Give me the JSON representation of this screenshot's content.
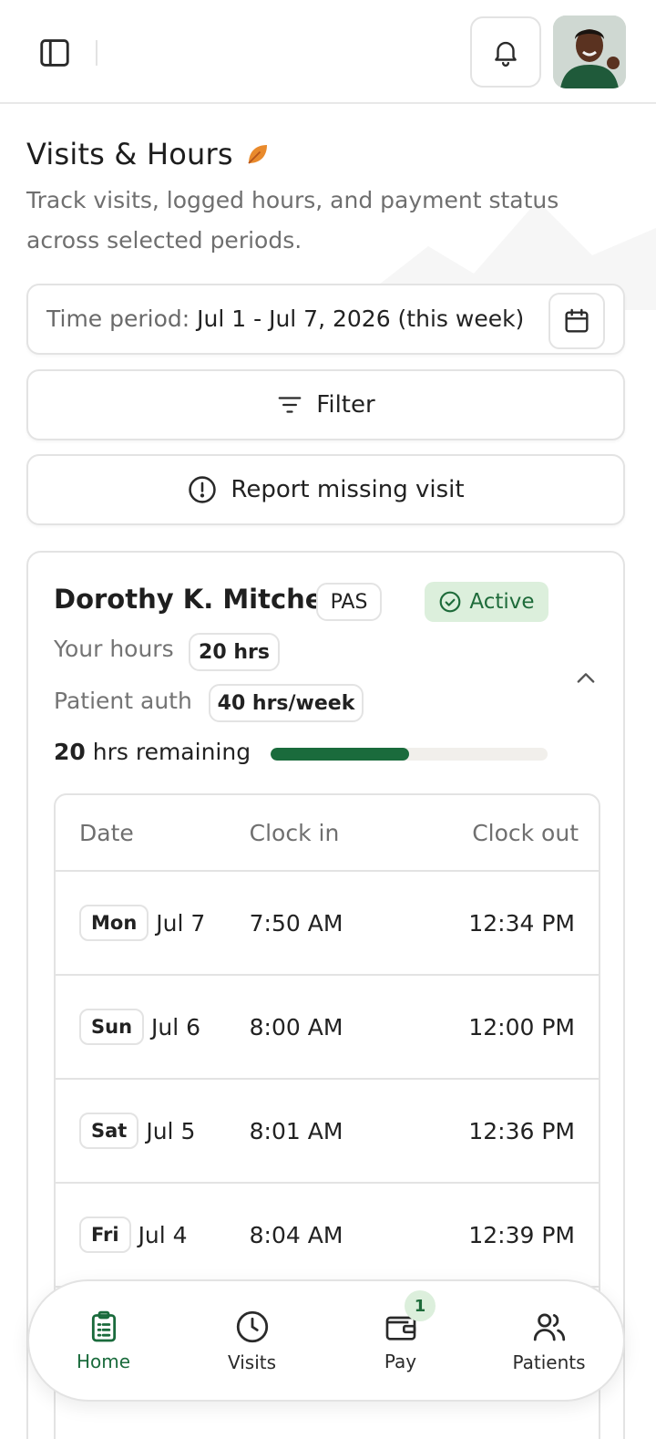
{
  "header": {
    "sidebar_icon": "sidebar-toggle-icon",
    "notifications_icon": "bell-icon",
    "avatar_alt": "user-avatar"
  },
  "page": {
    "title": "Visits & Hours",
    "title_icon": "leaf-icon",
    "subtitle": "Track visits, logged hours, and payment status across selected periods."
  },
  "period": {
    "label": "Time period: ",
    "value": "Jul 1 - Jul 7, 2026 (this week)",
    "icon": "calendar-icon"
  },
  "actions": {
    "filter_label": "Filter",
    "report_label": "Report missing visit"
  },
  "patient": {
    "name": "Dorothy K. Mitchell",
    "program": "PAS",
    "status": "Active",
    "your_hours_label": "Your hours",
    "your_hours_value": "20 hrs",
    "auth_label": "Patient auth",
    "auth_value": "40 hrs/week",
    "remaining_number": "20",
    "remaining_label": " hrs remaining",
    "progress_fraction": 0.5
  },
  "table": {
    "headers": [
      "Date",
      "Clock in",
      "Clock out"
    ],
    "rows": [
      {
        "day": "Mon",
        "date": "Jul 7",
        "in": "7:50 AM",
        "out": "12:34 PM"
      },
      {
        "day": "Sun",
        "date": "Jul 6",
        "in": "8:00 AM",
        "out": "12:00 PM"
      },
      {
        "day": "Sat",
        "date": "Jul 5",
        "in": "8:01 AM",
        "out": "12:36 PM"
      },
      {
        "day": "Fri",
        "date": "Jul 4",
        "in": "8:04 AM",
        "out": "12:39 PM"
      }
    ]
  },
  "nav": {
    "items": [
      {
        "label": "Home",
        "icon": "clipboard-icon"
      },
      {
        "label": "Visits",
        "icon": "clock-icon"
      },
      {
        "label": "Pay",
        "icon": "wallet-icon",
        "badge": "1"
      },
      {
        "label": "Patients",
        "icon": "users-icon"
      }
    ]
  },
  "colors": {
    "accent": "#1a6b3c",
    "status_bg": "#dcefdc",
    "border": "#e3e3e3"
  }
}
